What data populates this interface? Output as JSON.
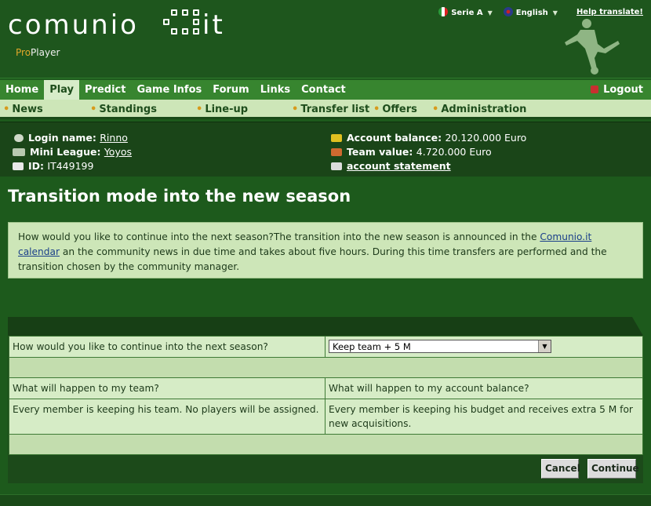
{
  "brand": {
    "logo_left": "comunio",
    "logo_right": "it",
    "pro": "Pro",
    "player": "Player"
  },
  "top_links": {
    "league": "Serie A",
    "language": "English",
    "help": "Help translate!"
  },
  "main_nav": {
    "items": [
      {
        "label": "Home"
      },
      {
        "label": "Play"
      },
      {
        "label": "Predict"
      },
      {
        "label": "Game Infos"
      },
      {
        "label": "Forum"
      },
      {
        "label": "Links"
      },
      {
        "label": "Contact"
      }
    ],
    "active": "Play",
    "logout": "Logout"
  },
  "sub_nav": {
    "items": [
      {
        "label": "News"
      },
      {
        "label": "Standings"
      },
      {
        "label": "Line-up"
      },
      {
        "label": "Transfer list"
      },
      {
        "label": "Offers"
      },
      {
        "label": "Administration"
      }
    ]
  },
  "account": {
    "login_label": "Login name:",
    "login_value": "Rinno",
    "league_label": "Mini League:",
    "league_value": "Yoyos",
    "id_label": "ID:",
    "id_value": "IT449199",
    "balance_label": "Account balance:",
    "balance_value": "20.120.000 Euro",
    "team_value_label": "Team value:",
    "team_value_value": "4.720.000 Euro",
    "statement_link": "account statement"
  },
  "page": {
    "title": "Transition mode into the new season",
    "info_part1": "How would you like to continue into the next season?The transition into the new season is announced in the ",
    "info_link": "Comunio.it calendar",
    "info_part2": "an the community news in due time and takes about five hours. During this time transfers are performed and the transition chosen by the community manager."
  },
  "form": {
    "question_label": "How would you like to continue into the next season?",
    "selected_option": "Keep team + 5 M",
    "team_question": "What will happen to my team?",
    "balance_question": "What will happen to my account balance?",
    "team_answer": "Every member is keeping his team. No players will be assigned.",
    "balance_answer": "Every member is keeping his budget and receives extra 5 M for new acquisitions.",
    "cancel_label": "Cancel",
    "continue_label": "Continue"
  },
  "colors": {
    "background": "#1d5a1c",
    "nav": "#37852f",
    "subnav": "#cde6b8",
    "accent_orange": "#e2a72a"
  }
}
